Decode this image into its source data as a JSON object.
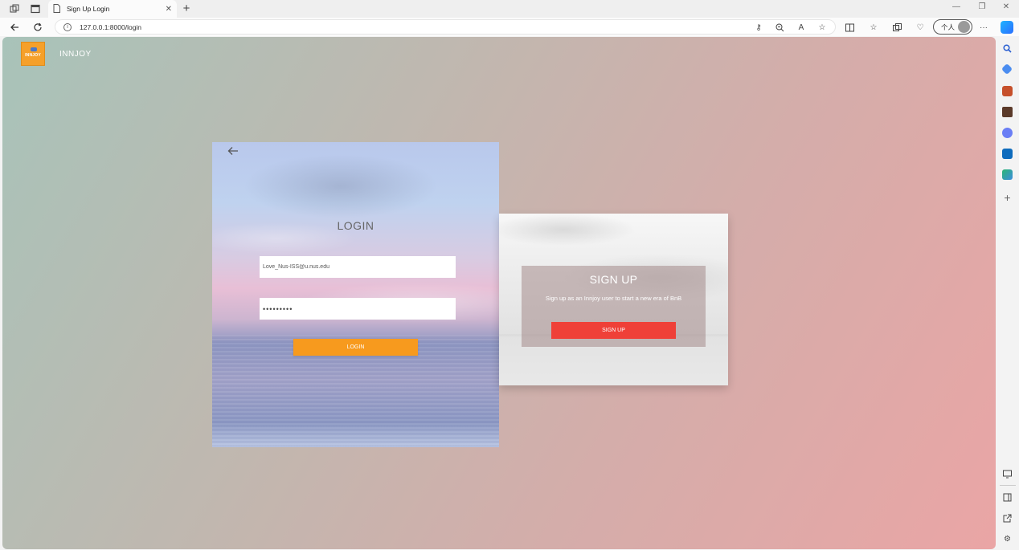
{
  "browser": {
    "tab_title": "Sign Up Login",
    "tab_close": "✕",
    "new_tab": "+",
    "url": "127.0.0.1:8000/login",
    "profile_label": "个人",
    "window": {
      "minimize": "—",
      "restore": "❐",
      "close": "✕"
    }
  },
  "site": {
    "brand_name": "INNJOY",
    "logo_text": "INNJOY"
  },
  "login": {
    "title": "LOGIN",
    "email_value": "Love_Nus-ISS@u.nus.edu",
    "password_value": "•••••••••",
    "button_label": "LOGIN"
  },
  "signup": {
    "title": "SIGN UP",
    "subtitle": "Sign up as an Innjoy user to start a new era of BnB",
    "button_label": "SIGN UP"
  },
  "colors": {
    "accent_orange": "#f79a1e",
    "signup_red": "#ef4038"
  }
}
